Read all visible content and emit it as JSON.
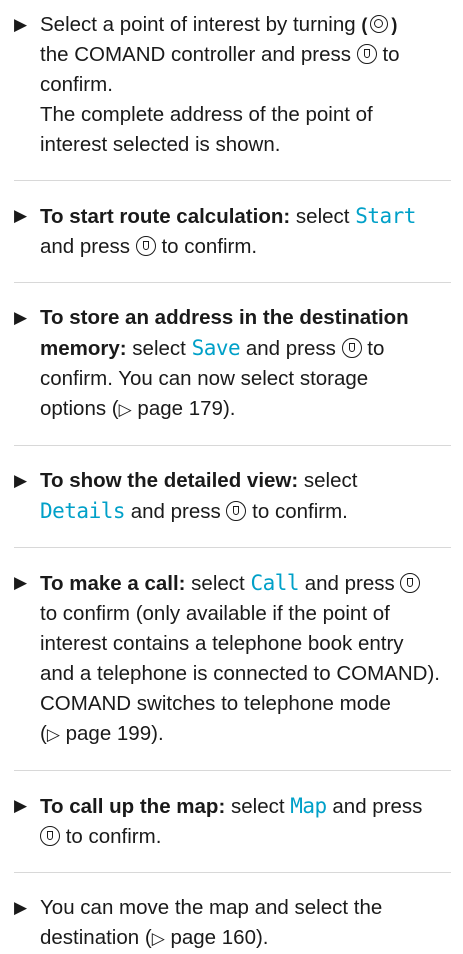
{
  "steps": [
    {
      "parts": [
        "Select a point of interest by turning",
        "the COMAND controller and press",
        "to",
        "confirm."
      ],
      "subtext": [
        "The complete address of the point of",
        "interest selected is shown."
      ]
    },
    {
      "bold": "To start route calculation:",
      "pre": "select",
      "option": "Start",
      "post1": "and press",
      "post2": "to confirm."
    },
    {
      "bold1": "To store an address in the destination",
      "bold2": "memory:",
      "pre": "select",
      "option": "Save",
      "post1": "and press",
      "post2": "to",
      "line2": "confirm. You can now select storage",
      "line3a": "options (",
      "ref": "▷",
      "page": "page 179",
      "line3b": ")."
    },
    {
      "bold": "To show the detailed view:",
      "pre": "select",
      "option": "Details",
      "post1": "and press",
      "post2": "to confirm."
    },
    {
      "bold": "To make a call:",
      "pre": "select",
      "option": "Call",
      "post1": "and press",
      "line2": "to confirm (only available if the point of",
      "line3": "interest contains a telephone book entry",
      "line4": "and a telephone is connected to COMAND).",
      "line5": "COMAND switches to telephone mode",
      "line6a": "(",
      "ref": "▷",
      "page": "page 199",
      "line6b": ")."
    },
    {
      "bold": "To call up the map:",
      "pre": "select",
      "option": "Map",
      "post1": "and press",
      "line2": "to confirm."
    },
    {
      "line1": "You can move the map and select the",
      "line2a": "destination (",
      "ref": "▷",
      "page": "page 160",
      "line2b": ")."
    }
  ]
}
